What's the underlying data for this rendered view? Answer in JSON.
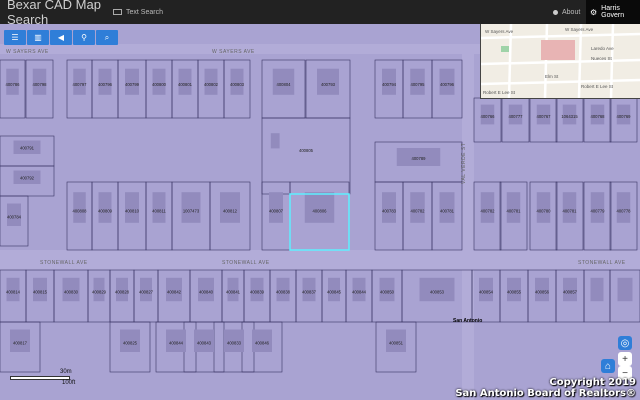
{
  "header": {
    "title": "Bexar CAD Map Search",
    "text_search_label": "Text Search",
    "about_label": "About",
    "harris_label": "Harris Govern"
  },
  "toolbar": {
    "buttons": [
      "layers-icon",
      "map-icon",
      "arrow-icon",
      "pin-icon",
      "search-icon"
    ]
  },
  "streets": [
    "W SAYERS AVE",
    "W SAYERS AVE",
    "STONEWALL AVE",
    "STONEWALL AVE",
    "STONEWALL AVE",
    "VAL VERDE ST"
  ],
  "place_label": "San Antonio",
  "parcels": {
    "row1": [
      "400786",
      "400798",
      "400797",
      "400796",
      "400799",
      "400800",
      "400801",
      "400802",
      "400803",
      "400804",
      "400793",
      "400794",
      "400795",
      "400796"
    ],
    "row1_right": [
      "400766",
      "400777",
      "400767",
      "1064315",
      "400768",
      "400769"
    ],
    "mid": [
      "400791",
      "400792",
      "400805",
      "400789"
    ],
    "row2": [
      "400808",
      "400809",
      "400810",
      "400811",
      "1007473",
      "400812",
      "400807",
      "400806",
      "400783",
      "400782",
      "400781",
      "400780",
      "400781",
      "400779",
      "400778"
    ],
    "left_row2": [
      "400784"
    ],
    "row3": [
      "400814",
      "400815",
      "400830",
      "400829",
      "400828",
      "400827",
      "400842",
      "400840",
      "400841",
      "400839",
      "400838",
      "400837",
      "400845",
      "400844",
      "400850",
      "400853",
      "400854",
      "400855",
      "400856",
      "400857"
    ],
    "row4": [
      "400844",
      "400843",
      "400833",
      "400846",
      "400851",
      "400817",
      "400825"
    ]
  },
  "inset_map": {
    "labels": [
      "W Sayers Ave",
      "W Sayers Ave",
      "Laredo Ave",
      "Nueces St",
      "Elm St",
      "Robert E Lee St",
      "Robert E Lee St"
    ],
    "highlight_color": "#e8b4b4"
  },
  "scale": {
    "top": "30m",
    "bottom": "100ft"
  },
  "copyright": {
    "line1": "Copyright 2019",
    "line2": "San Antonio Board of Realtors®"
  },
  "colors": {
    "navbar": "#222222",
    "parcel_fill": "#a9a3d2",
    "building": "#928bbd",
    "selected_outline": "#5ef0ff",
    "tool_button": "#2f7ed8"
  }
}
